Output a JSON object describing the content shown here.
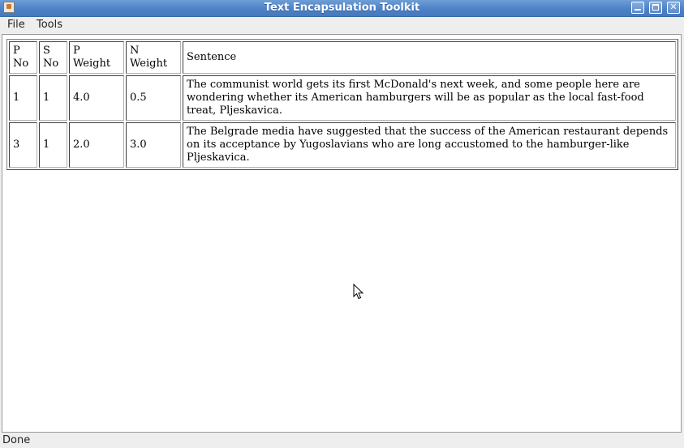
{
  "window": {
    "title": "Text Encapsulation Toolkit"
  },
  "menu": {
    "items": [
      {
        "label": "File"
      },
      {
        "label": "Tools"
      }
    ]
  },
  "table": {
    "headers": {
      "p_no": [
        "P",
        "No"
      ],
      "s_no": [
        "S",
        "No"
      ],
      "p_weight": [
        "P",
        "Weight"
      ],
      "n_weight": [
        "N",
        "Weight"
      ],
      "sentence": "Sentence"
    },
    "rows": [
      {
        "p_no": "1",
        "s_no": "1",
        "p_weight": "4.0",
        "n_weight": "0.5",
        "sentence": "The communist world gets its first McDonald's next week, and some people here are wondering whether its American hamburgers will be as popular as the local fast-food treat, Pljeskavica."
      },
      {
        "p_no": "3",
        "s_no": "1",
        "p_weight": "2.0",
        "n_weight": "3.0",
        "sentence": "The Belgrade media have suggested that the success of the American restaurant depends on its acceptance by Yugoslavians who are long accustomed to the hamburger-like Pljeskavica."
      }
    ]
  },
  "status": {
    "text": "Done"
  },
  "icons": {
    "app": "java-app-icon",
    "minimize": "minimize-icon",
    "maximize": "maximize-icon",
    "close": "close-icon",
    "cursor": "mouse-pointer-icon"
  },
  "colors": {
    "titlebar": "#4d82c6",
    "content_background": "#ffffff",
    "chrome_background": "#eeeeee"
  }
}
